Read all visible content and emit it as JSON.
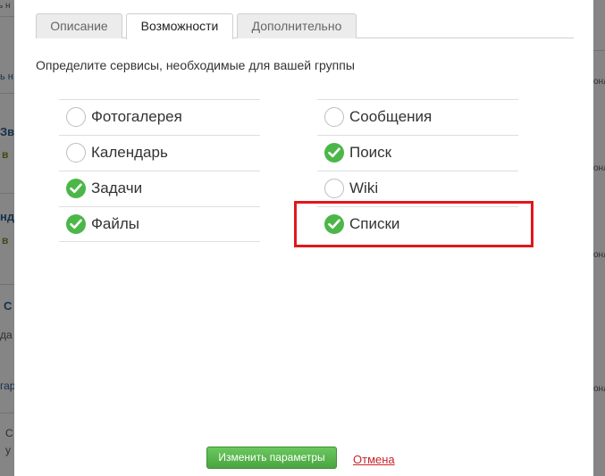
{
  "background": {
    "left_fragments": [
      "ь н",
      "Зв",
      "в",
      "нд",
      "в",
      "С",
      "да",
      "гар",
      "С",
      "у"
    ],
    "right_fragments": [
      "онл",
      "онл",
      "онл",
      "онл"
    ]
  },
  "modal": {
    "tabs": [
      {
        "label": "Описание",
        "active": false
      },
      {
        "label": "Возможности",
        "active": true
      },
      {
        "label": "Дополнительно",
        "active": false
      }
    ],
    "intro": "Определите сервисы, необходимые для вашей группы",
    "left_column": [
      {
        "label": "Фотогалерея",
        "checked": false
      },
      {
        "label": "Календарь",
        "checked": false
      },
      {
        "label": "Задачи",
        "checked": true
      },
      {
        "label": "Файлы",
        "checked": true
      }
    ],
    "right_column": [
      {
        "label": "Сообщения",
        "checked": false
      },
      {
        "label": "Поиск",
        "checked": true
      },
      {
        "label": "Wiki",
        "checked": false
      },
      {
        "label": "Списки",
        "checked": true
      }
    ],
    "save_label": "Изменить параметры",
    "cancel_label": "Отмена"
  },
  "colors": {
    "check_green": "#4cb748",
    "highlight_red": "#e0171b",
    "button_green": "#4aa540",
    "cancel_red": "#c9232b"
  }
}
